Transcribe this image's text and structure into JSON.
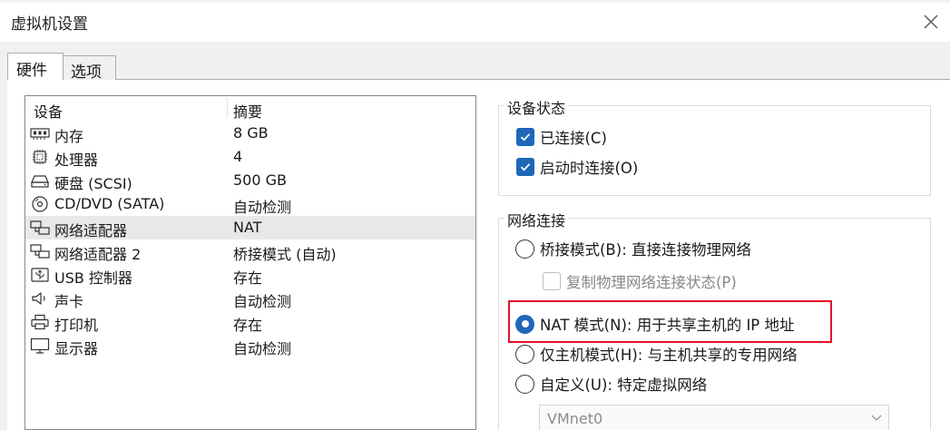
{
  "window": {
    "title": "虚拟机设置"
  },
  "tabs": [
    {
      "label": "硬件"
    },
    {
      "label": "选项"
    }
  ],
  "device_list": {
    "columns": {
      "device": "设备",
      "summary": "摘要"
    },
    "rows": [
      {
        "name": "内存",
        "summary": "8 GB",
        "icon": "memory-icon"
      },
      {
        "name": "处理器",
        "summary": "4",
        "icon": "processor-icon"
      },
      {
        "name": "硬盘 (SCSI)",
        "summary": "500 GB",
        "icon": "hard-disk-icon"
      },
      {
        "name": "CD/DVD (SATA)",
        "summary": "自动检测",
        "icon": "cd-dvd-icon"
      },
      {
        "name": "网络适配器",
        "summary": "NAT",
        "icon": "network-adapter-icon",
        "selected": true
      },
      {
        "name": "网络适配器 2",
        "summary": "桥接模式 (自动)",
        "icon": "network-adapter-icon"
      },
      {
        "name": "USB 控制器",
        "summary": "存在",
        "icon": "usb-icon"
      },
      {
        "name": "声卡",
        "summary": "自动检测",
        "icon": "sound-card-icon"
      },
      {
        "name": "打印机",
        "summary": "存在",
        "icon": "printer-icon"
      },
      {
        "name": "显示器",
        "summary": "自动检测",
        "icon": "display-icon"
      }
    ]
  },
  "device_status": {
    "title": "设备状态",
    "connected": {
      "label": "已连接(C)",
      "checked": true
    },
    "connect_at_power_on": {
      "label": "启动时连接(O)",
      "checked": true
    }
  },
  "network_connection": {
    "title": "网络连接",
    "bridged": {
      "label": "桥接模式(B): 直接连接物理网络",
      "selected": false
    },
    "replicate_state": {
      "label": "复制物理网络连接状态(P)",
      "checked": false,
      "disabled": true
    },
    "nat": {
      "label": "NAT 模式(N): 用于共享主机的 IP 地址",
      "selected": true
    },
    "host_only": {
      "label": "仅主机模式(H): 与主机共享的专用网络",
      "selected": false
    },
    "custom": {
      "label": "自定义(U): 特定虚拟网络",
      "selected": false
    },
    "custom_select": {
      "value": "VMnet0"
    }
  },
  "colors": {
    "accent": "#1f67b8",
    "highlight": "#e0152b"
  }
}
